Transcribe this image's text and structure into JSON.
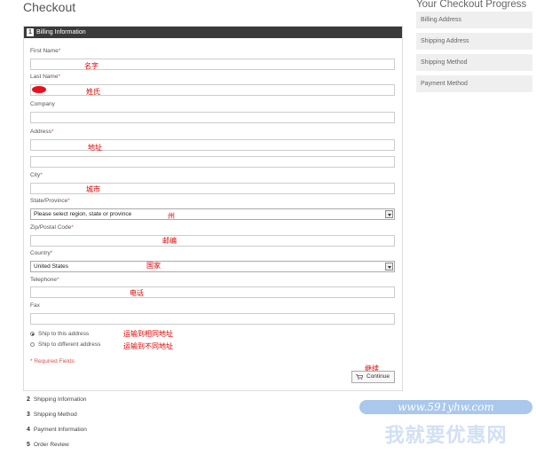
{
  "page_title": "Checkout",
  "progress": {
    "title": "Your Checkout Progress",
    "items": [
      "Billing Address",
      "Shipping Address",
      "Shipping Method",
      "Payment Method"
    ]
  },
  "billing": {
    "step_number": "1",
    "header": "Billing Information",
    "fields": {
      "first_name": "First Name",
      "last_name": "Last Name",
      "company": "Company",
      "address": "Address",
      "city": "City",
      "state": "State/Province",
      "zip": "Zip/Postal Code",
      "country": "Country",
      "telephone": "Telephone",
      "fax": "Fax"
    },
    "required_mark": "*",
    "state_select_value": "Please select region, state or province",
    "country_select_value": "United States",
    "ship_options": [
      "Ship to this address",
      "Ship to different address"
    ],
    "required_note": "* Required Fields",
    "continue_label": "Continue"
  },
  "annotations": {
    "first_name": "名字",
    "last_name": "姓氏",
    "address": "地址",
    "city": "城市",
    "state": "州",
    "zip": "邮编",
    "country": "国家",
    "telephone": "电话",
    "ship_same": "运输到相同地址",
    "ship_diff": "运输到不同地址",
    "continue": "继续"
  },
  "steps": [
    {
      "num": "2",
      "label": "Shipping Information"
    },
    {
      "num": "3",
      "label": "Shipping Method"
    },
    {
      "num": "4",
      "label": "Payment Information"
    },
    {
      "num": "5",
      "label": "Order Review"
    }
  ],
  "watermark": {
    "url": "www.591yhw.com",
    "text": "我就要优惠网"
  },
  "colors": {
    "header_bg": "#3a3a3a",
    "required": "#d9534f",
    "annotation": "#dd0000",
    "progress_bg": "#efefef"
  }
}
